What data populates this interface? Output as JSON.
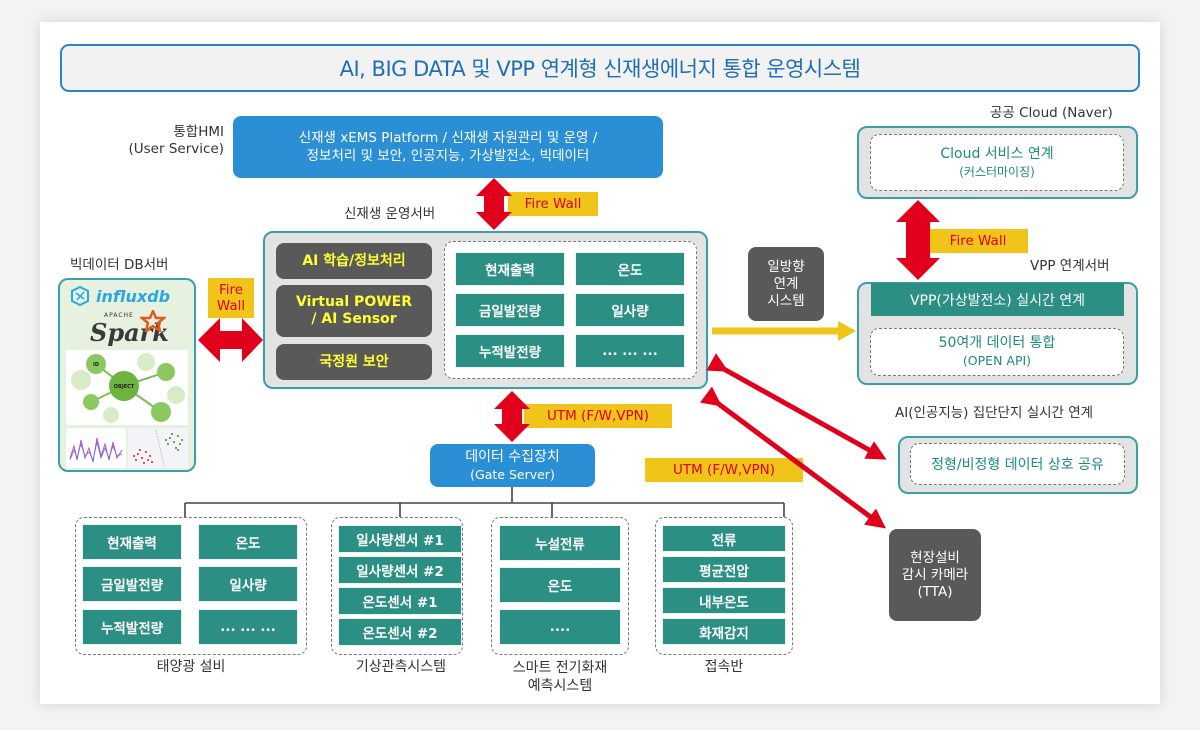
{
  "title": "AI, BIG DATA 및 VPP 연계형 신재생에너지 통합 운영시스템",
  "hmi": {
    "label_line1": "통합HMI",
    "label_line2": "(User Service)",
    "box_line1": "신재생 xEMS Platform / 신재생 자원관리 및 운영 /",
    "box_line2": "정보처리 및 보안, 인공지능, 가상발전소, 빅데이터"
  },
  "firewall_top": "Fire Wall",
  "ops_server": {
    "label": "신재생 운영서버",
    "modules": [
      {
        "line1": "AI 학습/정보처리",
        "line2": ""
      },
      {
        "line1": "Virtual POWER",
        "line2": "/ AI Sensor"
      },
      {
        "line1": "국정원 보안",
        "line2": ""
      }
    ],
    "data_cells": [
      "현재출력",
      "온도",
      "금일발전량",
      "일사량",
      "누적발전량",
      "... ... ..."
    ]
  },
  "bigdata": {
    "label": "빅데이터 DB서버",
    "logos": [
      "influxdb",
      "APACHE",
      "Spark"
    ],
    "graph_nodes": [
      "ID",
      "OBJECT"
    ],
    "firewall_line1": "Fire",
    "firewall_line2": "Wall"
  },
  "oneway": {
    "line1": "일방향",
    "line2": "연계",
    "line3": "시스템"
  },
  "cloud": {
    "label": "공공 Cloud (Naver)",
    "service_line1": "Cloud 서비스 연계",
    "service_line2": "(커스터마이징)",
    "firewall": "Fire Wall"
  },
  "vpp": {
    "label": "VPP 연계서버",
    "header": "VPP(가상발전소) 실시간 연계",
    "data_line1": "50여개 데이터 통합",
    "data_line2": "(OPEN API)"
  },
  "ai_complex": {
    "label": "AI(인공지능) 집단단지 실시간 연계",
    "box": "정형/비정형 데이터 상호 공유"
  },
  "utm_center": "UTM (F/W,VPN)",
  "utm_right": "UTM (F/W,VPN)",
  "camera": {
    "line1": "현장설비",
    "line2": "감시 카메라",
    "line3": "(TTA)"
  },
  "gateway": {
    "line1": "데이터 수집장치",
    "line2": "(Gate Server)"
  },
  "groups": [
    {
      "name": "태양광 설비",
      "name_line2": "",
      "items": [
        "현재출력",
        "온도",
        "금일발전량",
        "일사량",
        "누적발전량",
        "... ... ..."
      ]
    },
    {
      "name": "기상관측시스템",
      "name_line2": "",
      "items": [
        "일사량센서 #1",
        "일사량센서 #2",
        "온도센서 #1",
        "온도센서 #2"
      ]
    },
    {
      "name": "스마트 전기화재",
      "name_line2": "예측시스템",
      "items": [
        "누설전류",
        "온도",
        "...."
      ]
    },
    {
      "name": "접속반",
      "name_line2": "",
      "items": [
        "전류",
        "평균전압",
        "내부온도",
        "화재감지"
      ]
    }
  ],
  "colors": {
    "title_border": "#2d83c5",
    "blue": "#2a8fd4",
    "teal": "#2b8f84",
    "frame": "#3aa0a8",
    "dark": "#595959",
    "arrow_red": "#e0001b",
    "tag_yellow": "#f0c419"
  }
}
